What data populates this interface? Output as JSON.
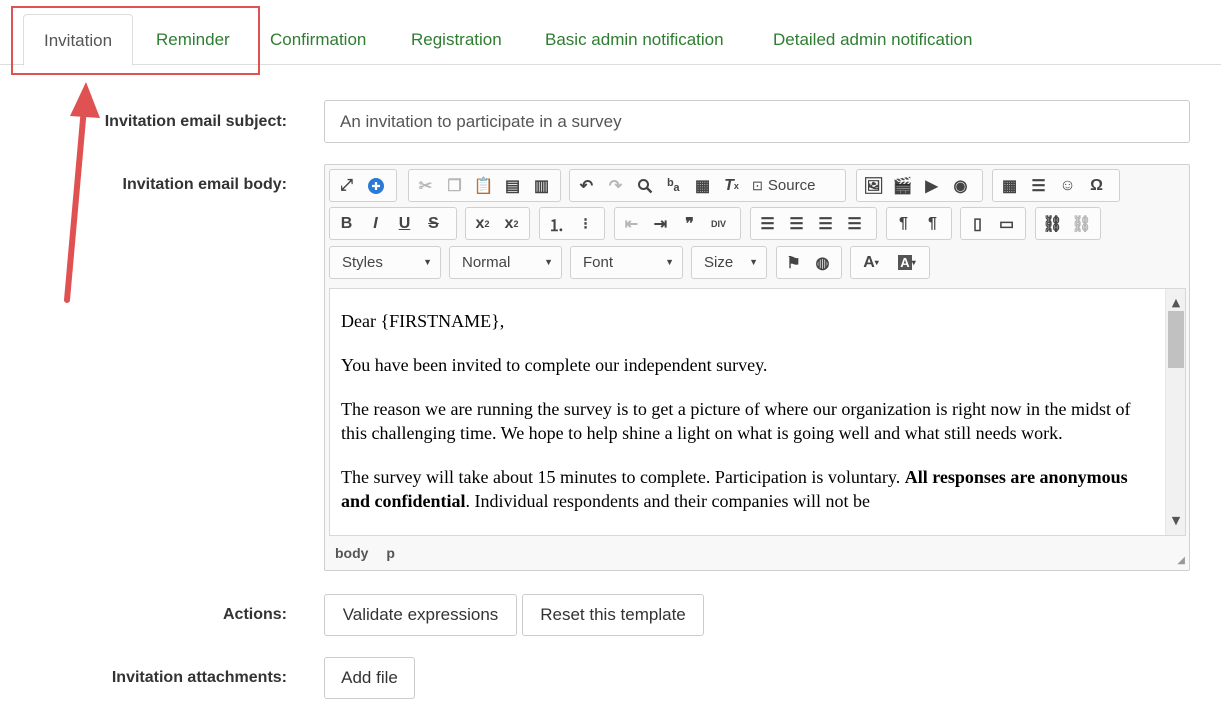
{
  "tabs": [
    {
      "label": "Invitation",
      "active": true
    },
    {
      "label": "Reminder"
    },
    {
      "label": "Confirmation"
    },
    {
      "label": "Registration"
    },
    {
      "label": "Basic admin notification"
    },
    {
      "label": "Detailed admin notification"
    }
  ],
  "form": {
    "subject_label": "Invitation email subject:",
    "subject_value": "An invitation to participate in a survey",
    "body_label": "Invitation email body:",
    "actions_label": "Actions:",
    "attachments_label": "Invitation attachments:"
  },
  "toolbar": {
    "source_label": "Source",
    "styles": "Styles",
    "format": "Normal",
    "font": "Font",
    "size": "Size"
  },
  "editor": {
    "greeting": "Dear {FIRSTNAME},",
    "p1": "You have been invited to complete our independent survey.",
    "p2_a": "The reason we are running the survey is to get a picture of where our organization is right now in the midst of this challenging time. We hope to help shine a light on what is going well and what still needs work.",
    "p3_a": "The survey will take about 15 minutes to complete. Participation is voluntary. ",
    "p3_bold": "All responses are anonymous and confidential",
    "p3_b": ". Individual respondents and their companies will not be",
    "path": [
      "body",
      "p"
    ]
  },
  "buttons": {
    "validate": "Validate expressions",
    "reset": "Reset this template",
    "add_file": "Add file"
  },
  "colors": {
    "tab_text": "#2e7d32",
    "highlight": "#e05252"
  }
}
